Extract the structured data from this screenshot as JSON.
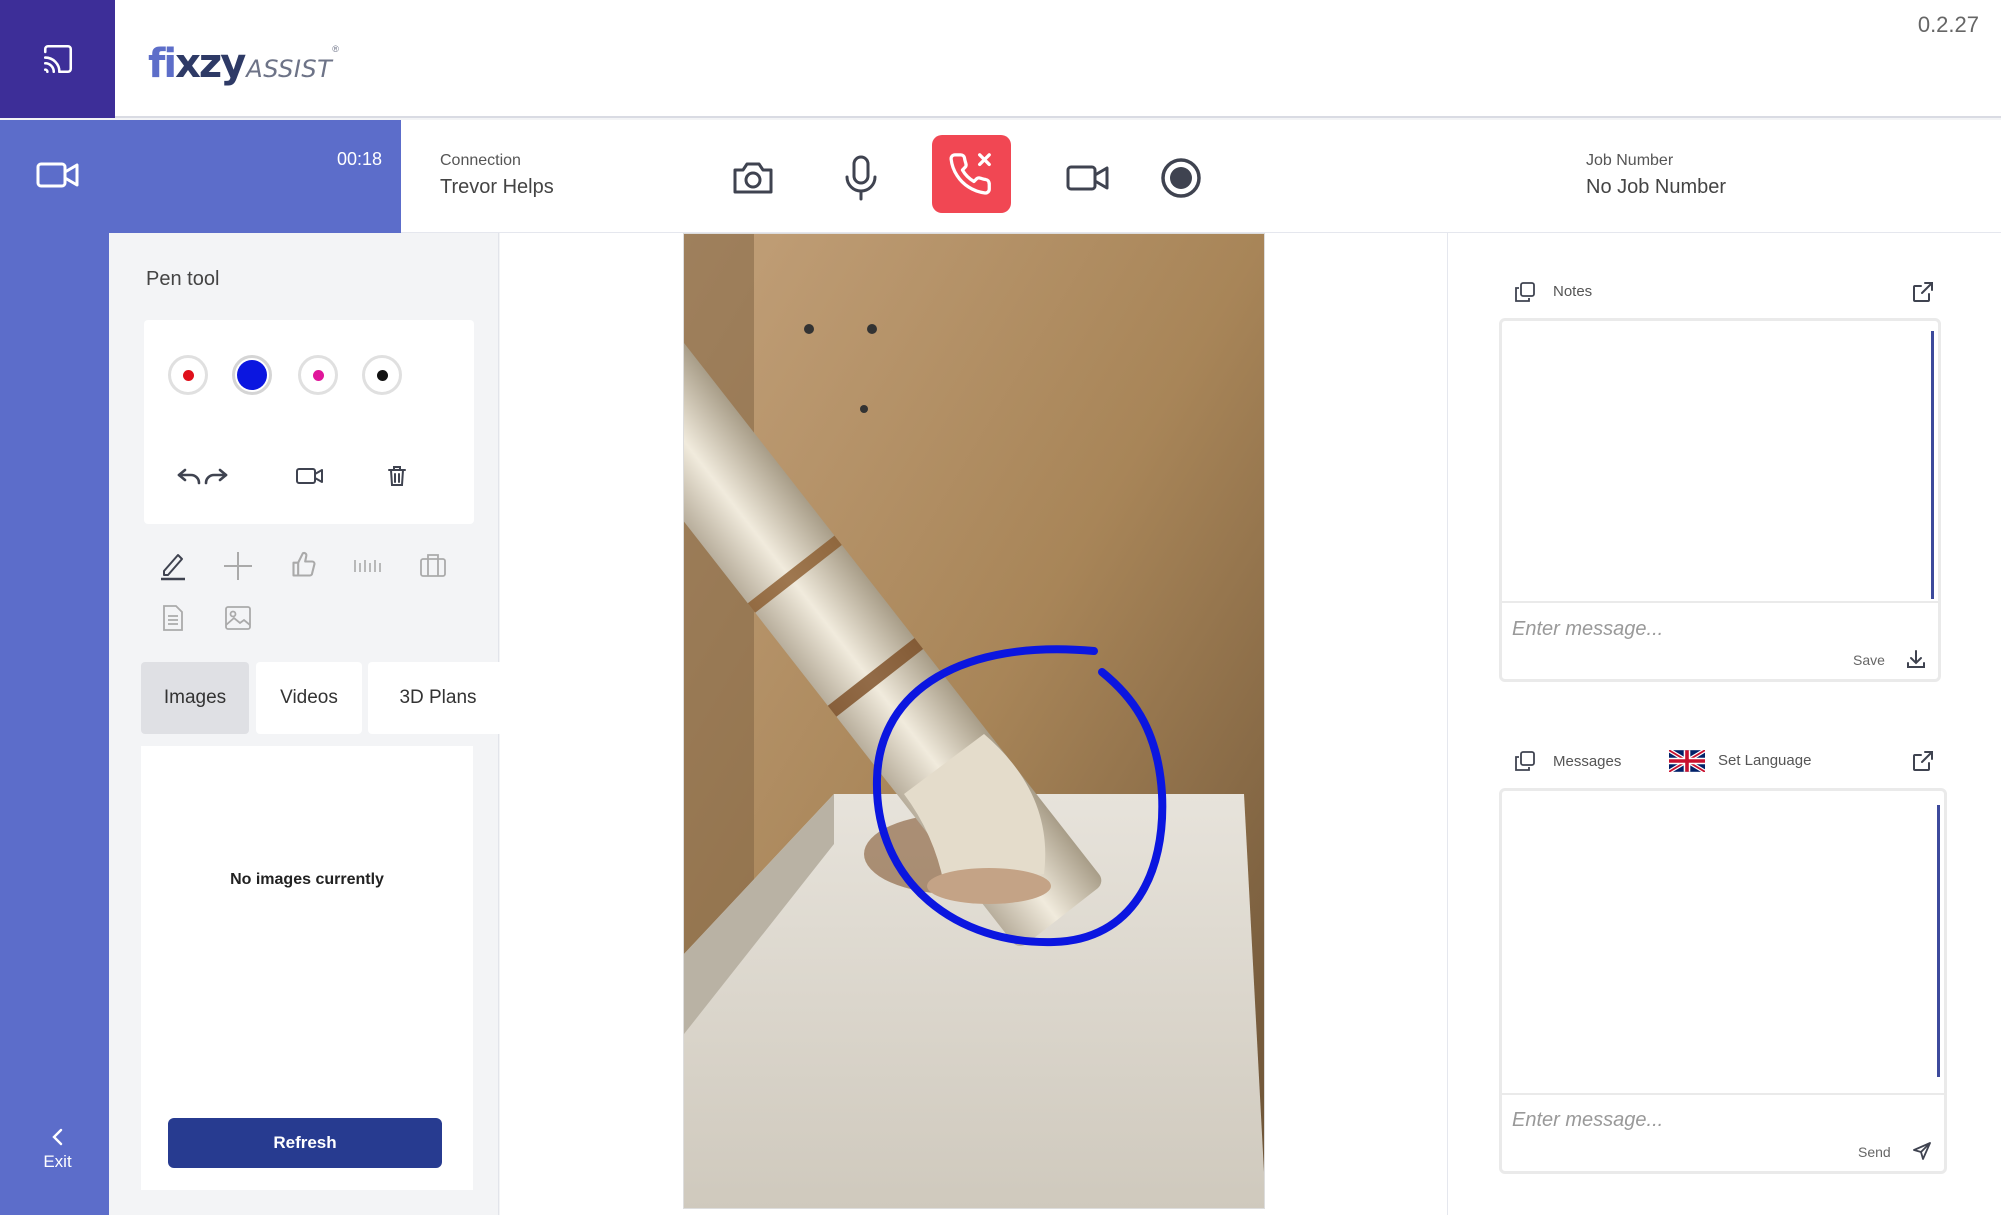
{
  "header": {
    "brand": "fixzy",
    "brand_suffix": "ASSIST",
    "version": "0.2.27"
  },
  "call": {
    "timer": "00:18",
    "connection_label": "Connection",
    "connection_value": "Trevor Helps",
    "job_label": "Job Number",
    "job_value": "No Job Number",
    "end_call_color": "#f14753"
  },
  "nav": {
    "exit_label": "Exit"
  },
  "pen_tool": {
    "title": "Pen tool",
    "colors": [
      "#e0101b",
      "#0b16e0",
      "#e0169a",
      "#111111"
    ],
    "selected_color": "#0b16e0"
  },
  "media": {
    "tabs": [
      "Images",
      "Videos",
      "3D Plans"
    ],
    "active_tab": "Images",
    "empty_text": "No images currently",
    "refresh_label": "Refresh"
  },
  "notes": {
    "title": "Notes",
    "placeholder": "Enter message...",
    "save_label": "Save"
  },
  "messages": {
    "title": "Messages",
    "language_label": "Set Language",
    "placeholder": "Enter message...",
    "send_label": "Send"
  },
  "colors": {
    "accent": "#5c6dca",
    "sidebar_dark": "#3d2e98",
    "button_dark": "#273b90"
  }
}
